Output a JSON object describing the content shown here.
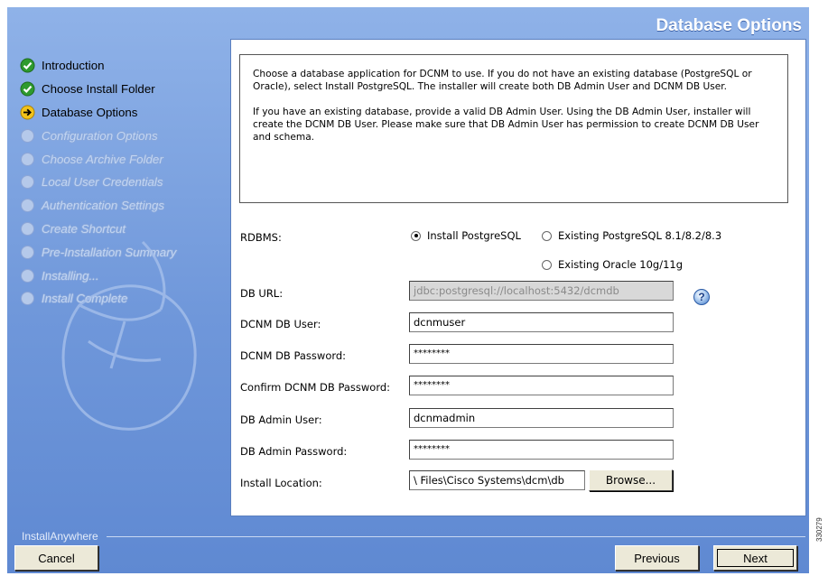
{
  "window": {
    "title": "Database Options"
  },
  "steps": [
    {
      "label": "Introduction",
      "state": "done"
    },
    {
      "label": "Choose Install Folder",
      "state": "done"
    },
    {
      "label": "Database Options",
      "state": "current"
    },
    {
      "label": "Configuration Options",
      "state": "pending"
    },
    {
      "label": "Choose Archive Folder",
      "state": "pending"
    },
    {
      "label": "Local User Credentials",
      "state": "pending"
    },
    {
      "label": "Authentication Settings",
      "state": "pending"
    },
    {
      "label": "Create Shortcut",
      "state": "pending"
    },
    {
      "label": "Pre-Installation Summary",
      "state": "pending"
    },
    {
      "label": "Installing...",
      "state": "pending"
    },
    {
      "label": "Install Complete",
      "state": "pending"
    }
  ],
  "info": {
    "paragraph1": "Choose a database application for DCNM to use. If you do not have an existing database (PostgreSQL or Oracle), select Install PostgreSQL. The installer will create both DB Admin User and DCNM DB User.",
    "paragraph2": "If you have an existing database, provide a valid DB Admin User. Using the DB Admin User, installer will create the DCNM DB User. Please make sure that DB Admin User has permission to create DCNM DB User and schema."
  },
  "form": {
    "rdbms_label": "RDBMS:",
    "rdbms_options": [
      {
        "label": "Install PostgreSQL",
        "selected": true
      },
      {
        "label": "Existing PostgreSQL 8.1/8.2/8.3",
        "selected": false
      },
      {
        "label": "Existing Oracle 10g/11g",
        "selected": false
      }
    ],
    "db_url_label": "DB URL:",
    "db_url_value": "jdbc:postgresql://localhost:5432/dcmdb",
    "dcnm_user_label": "DCNM DB User:",
    "dcnm_user_value": "dcnmuser",
    "dcnm_password_label": "DCNM DB Password:",
    "dcnm_password_value": "********",
    "confirm_password_label": "Confirm DCNM DB Password:",
    "confirm_password_value": "********",
    "admin_user_label": "DB Admin User:",
    "admin_user_value": "dcnmadmin",
    "admin_password_label": "DB Admin Password:",
    "admin_password_value": "********",
    "install_location_label": "Install Location:",
    "install_location_value": "\\ Files\\Cisco Systems\\dcm\\db",
    "browse_label": "Browse...",
    "help_glyph": "?"
  },
  "footer": {
    "brand": "InstallAnywhere",
    "cancel_label": "Cancel",
    "previous_label": "Previous",
    "next_label": "Next"
  },
  "figure_number": "330279",
  "colors": {
    "sidebar_gradient_top": "#8fb2e8",
    "sidebar_gradient_bottom": "#5f89d2",
    "done_icon": "#2e9a2e",
    "current_icon": "#f2c21a"
  }
}
